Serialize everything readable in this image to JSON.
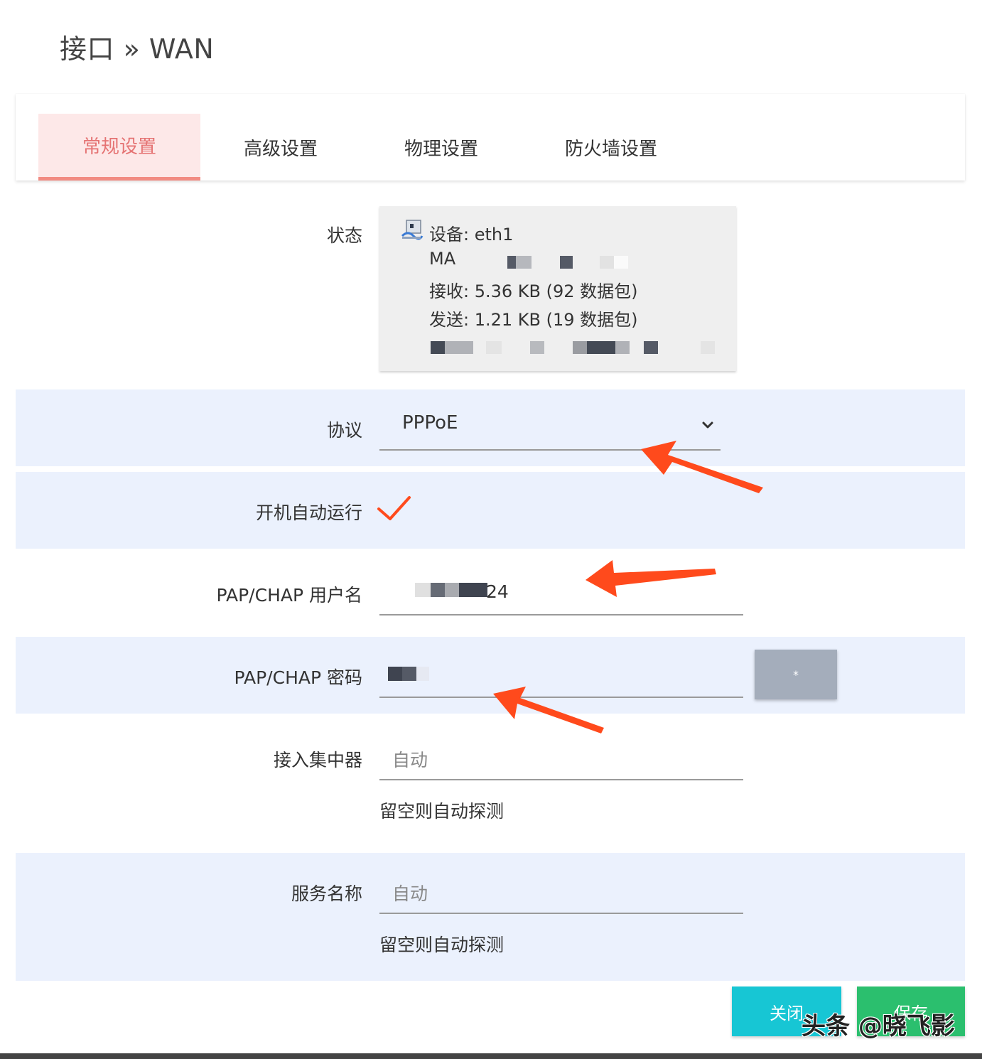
{
  "header": {
    "title": "接口 » WAN"
  },
  "tabs": [
    {
      "label": "常规设置",
      "active": true
    },
    {
      "label": "高级设置",
      "active": false
    },
    {
      "label": "物理设置",
      "active": false
    },
    {
      "label": "防火墙设置",
      "active": false
    }
  ],
  "status": {
    "label": "状态",
    "device": "设备: eth1",
    "mac_prefix": "MA",
    "rx": "接收: 5.36 KB (92 数据包)",
    "tx": "发送: 1.21 KB (19 数据包)",
    "icon": "network-device-icon"
  },
  "protocol": {
    "label": "协议",
    "value": "PPPoE"
  },
  "autostart": {
    "label": "开机自动运行",
    "checked": true
  },
  "username": {
    "label": "PAP/CHAP 用户名",
    "value_suffix": "24"
  },
  "password": {
    "label": "PAP/CHAP 密码",
    "reveal_label": "*"
  },
  "concentrator": {
    "label": "接入集中器",
    "placeholder": "自动",
    "hint": "留空则自动探测"
  },
  "service": {
    "label": "服务名称",
    "placeholder": "自动",
    "hint": "留空则自动探测"
  },
  "actions": {
    "close_label": "关闭",
    "save_label": "保存"
  },
  "watermark": "头条 @晓飞影",
  "colors": {
    "tab_active_bg": "#fde8e8",
    "tab_active_text": "#e57373",
    "row_shade": "#ebf1fd",
    "check": "#ff4a1c",
    "arrow": "#ff4a1c",
    "close_btn": "#17c6d4",
    "save_btn": "#2bbf6e",
    "reveal_btn": "#a4adbb"
  }
}
